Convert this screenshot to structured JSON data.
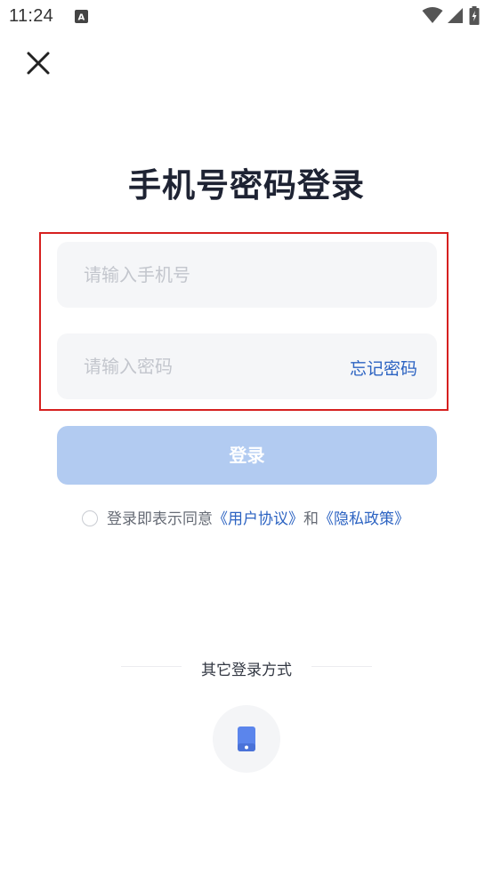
{
  "status_bar": {
    "time": "11:24",
    "notification_icon": "a-notification-icon",
    "wifi_icon": "wifi-icon",
    "signal_icon": "cell-signal-icon",
    "battery_icon": "battery-charging-icon"
  },
  "header": {
    "close_icon": "close-icon"
  },
  "title": "手机号密码登录",
  "form": {
    "phone_placeholder": "请输入手机号",
    "password_placeholder": "请输入密码",
    "forgot_password": "忘记密码",
    "login_label": "登录"
  },
  "agreement": {
    "prefix": "登录即表示同意",
    "user_agreement": "《用户协议》",
    "conjunction": "和",
    "privacy_policy": "《隐私政策》",
    "checked": false
  },
  "other_login": {
    "title": "其它登录方式",
    "phone_option_icon": "mobile-phone-icon"
  },
  "colors": {
    "accent": "#2c63c2",
    "button_disabled": "#b2cbf1",
    "highlight_border": "#d6201f",
    "input_bg": "#f5f6f8"
  }
}
